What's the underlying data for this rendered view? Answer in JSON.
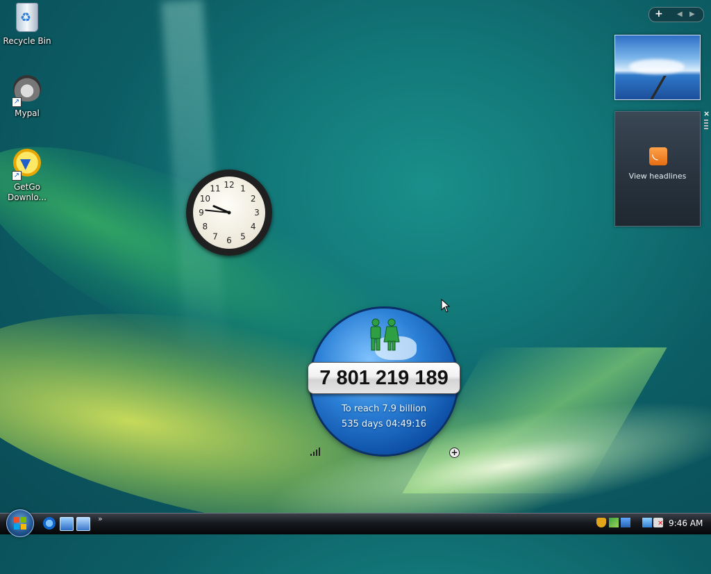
{
  "desktop": {
    "icons": [
      {
        "label": "Recycle Bin",
        "icon": "recycle-bin-icon"
      },
      {
        "label": "Mypal",
        "icon": "mypal-raccoon-icon"
      },
      {
        "label": "GetGo Downlo...",
        "icon": "getgo-download-icon"
      }
    ]
  },
  "clock_gadget": {
    "numbers": [
      "12",
      "1",
      "2",
      "3",
      "4",
      "5",
      "6",
      "7",
      "8",
      "9",
      "10",
      "11"
    ],
    "hour": 9,
    "minute": 46
  },
  "sidebar": {
    "controls": {
      "add": "+",
      "prev": "◀",
      "next": "▶"
    },
    "slideshow": {
      "icon": "slideshow-photo"
    },
    "feed": {
      "label": "View headlines",
      "icon": "rss-feed-icon"
    },
    "close": "×"
  },
  "population_gadget": {
    "count": "7 801 219 189",
    "target_text": "To reach 7.9 billion",
    "countdown": "535 days 04:49:16",
    "add_icon": "+"
  },
  "taskbar": {
    "more": "»",
    "clock": "9:46 AM"
  },
  "colors": {
    "accent": "#1d4f8a",
    "globe": "#2b80d6",
    "people": "#2ea043"
  }
}
